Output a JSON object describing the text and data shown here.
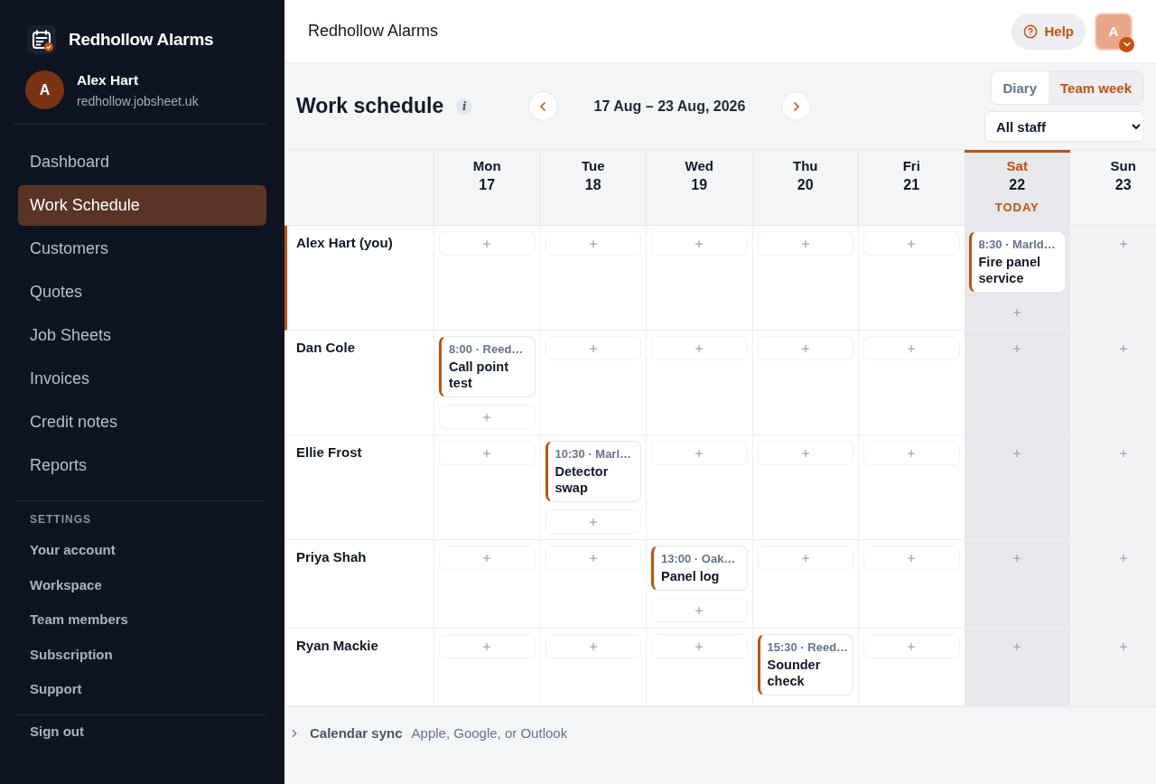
{
  "sidebar": {
    "brand": "Redhollow Alarms",
    "user": {
      "initial": "A",
      "name": "Alex Hart",
      "domain": "redhollow.jobsheet.uk"
    },
    "nav": [
      {
        "label": "Dashboard",
        "selected": false
      },
      {
        "label": "Work Schedule",
        "selected": true
      },
      {
        "label": "Customers",
        "selected": false
      },
      {
        "label": "Quotes",
        "selected": false
      },
      {
        "label": "Job Sheets",
        "selected": false
      },
      {
        "label": "Invoices",
        "selected": false
      },
      {
        "label": "Credit notes",
        "selected": false
      },
      {
        "label": "Reports",
        "selected": false
      }
    ],
    "settings_heading": "SETTINGS",
    "settings": [
      "Your account",
      "Workspace",
      "Team members",
      "Subscription",
      "Support"
    ],
    "sign_out": "Sign out"
  },
  "topbar": {
    "title": "Redhollow Alarms",
    "help": "Help",
    "avatar": "A"
  },
  "header": {
    "title": "Work schedule",
    "info": "i",
    "range": "17 Aug – 23 Aug, 2026",
    "views": [
      {
        "label": "Diary",
        "selected": false
      },
      {
        "label": "Team week",
        "selected": true
      }
    ],
    "staff_filter": "All staff"
  },
  "days": [
    {
      "name": "Mon",
      "date": "17",
      "kind": "weekday",
      "today": false
    },
    {
      "name": "Tue",
      "date": "18",
      "kind": "weekday",
      "today": false
    },
    {
      "name": "Wed",
      "date": "19",
      "kind": "weekday",
      "today": false
    },
    {
      "name": "Thu",
      "date": "20",
      "kind": "weekday",
      "today": false
    },
    {
      "name": "Fri",
      "date": "21",
      "kind": "weekday",
      "today": false
    },
    {
      "name": "Sat",
      "date": "22",
      "kind": "weekend",
      "today": true,
      "today_label": "TODAY"
    },
    {
      "name": "Sun",
      "date": "23",
      "kind": "weekend",
      "today": false
    }
  ],
  "rows": [
    {
      "name": "Alex Hart (you)",
      "current": true,
      "cells": [
        {
          "add": true
        },
        {
          "add": true
        },
        {
          "add": true
        },
        {
          "add": true
        },
        {
          "add": true
        },
        {
          "add": true,
          "events": [
            {
              "when": "8:30 · Marld…",
              "title": "Fire panel service"
            }
          ]
        },
        {
          "add": true
        }
      ]
    },
    {
      "name": "Dan Cole",
      "current": false,
      "cells": [
        {
          "add": true,
          "events": [
            {
              "when": "8:00 · Reed…",
              "title": "Call point test"
            }
          ]
        },
        {
          "add": true
        },
        {
          "add": true
        },
        {
          "add": true
        },
        {
          "add": true
        },
        {
          "add": true
        },
        {
          "add": true
        }
      ]
    },
    {
      "name": "Ellie Frost",
      "current": false,
      "cells": [
        {
          "add": true
        },
        {
          "add": true,
          "events": [
            {
              "when": "10:30 · Marl…",
              "title": "Detector swap"
            }
          ]
        },
        {
          "add": true
        },
        {
          "add": true
        },
        {
          "add": true
        },
        {
          "add": true
        },
        {
          "add": true
        }
      ]
    },
    {
      "name": "Priya Shah",
      "current": false,
      "cells": [
        {
          "add": true
        },
        {
          "add": true
        },
        {
          "add": true,
          "events": [
            {
              "when": "13:00 · Oak…",
              "title": "Panel log"
            }
          ]
        },
        {
          "add": true
        },
        {
          "add": true
        },
        {
          "add": true
        },
        {
          "add": true
        }
      ]
    },
    {
      "name": "Ryan Mackie",
      "current": false,
      "cells": [
        {
          "add": true
        },
        {
          "add": true
        },
        {
          "add": true
        },
        {
          "add": false,
          "events": [
            {
              "when": "15:30 · Reed…",
              "title": "Sounder check"
            }
          ]
        },
        {
          "add": true
        },
        {
          "add": true
        },
        {
          "add": true
        }
      ]
    }
  ],
  "footer": {
    "label": "Calendar sync",
    "detail": "Apple, Google, or Outlook"
  }
}
